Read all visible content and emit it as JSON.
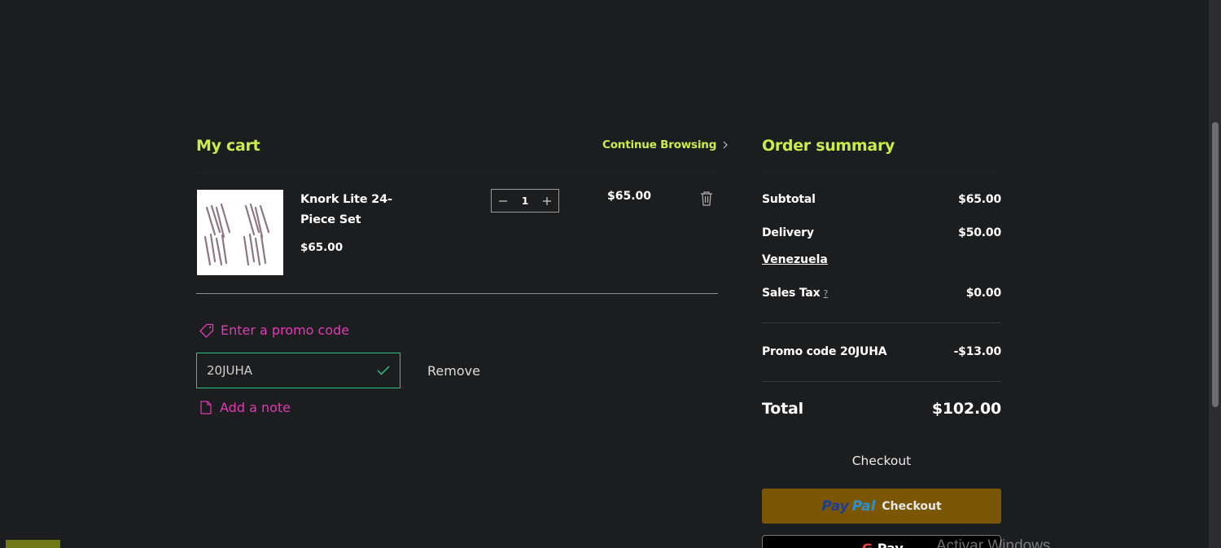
{
  "cart": {
    "title": "My cart",
    "continue_label": "Continue Browsing",
    "item": {
      "name": "Knork Lite 24-Piece Set",
      "price": "$65.00",
      "quantity": "1",
      "line_total": "$65.00"
    },
    "promo_link": "Enter a promo code",
    "promo_value": "20JUHA",
    "remove_label": "Remove",
    "note_link": "Add a note"
  },
  "summary": {
    "title": "Order summary",
    "subtotal_label": "Subtotal",
    "subtotal_value": "$65.00",
    "delivery_label": "Delivery",
    "delivery_value": "$50.00",
    "delivery_location": "Venezuela",
    "tax_label": "Sales Tax",
    "tax_help": "?",
    "tax_value": "$0.00",
    "promo_label": "Promo code 20JUHA",
    "promo_value": "-$13.00",
    "total_label": "Total",
    "total_value": "$102.00",
    "checkout_label": "Checkout",
    "paypal_brand_1": "Pay",
    "paypal_brand_2": "Pal",
    "paypal_label": "Checkout",
    "gpay_label_g": "G",
    "gpay_label_rest": "Pay"
  },
  "system": {
    "watermark": "Activar Windows"
  },
  "colors": {
    "accent": "#c9ee4a",
    "link": "#e03ab5",
    "background": "#1c1d1f",
    "paypal": "#7b5705",
    "success": "#2bc486"
  },
  "icons": [
    "chevron-right-icon",
    "minus-icon",
    "plus-icon",
    "trash-icon",
    "tag-icon",
    "check-icon",
    "note-icon"
  ]
}
